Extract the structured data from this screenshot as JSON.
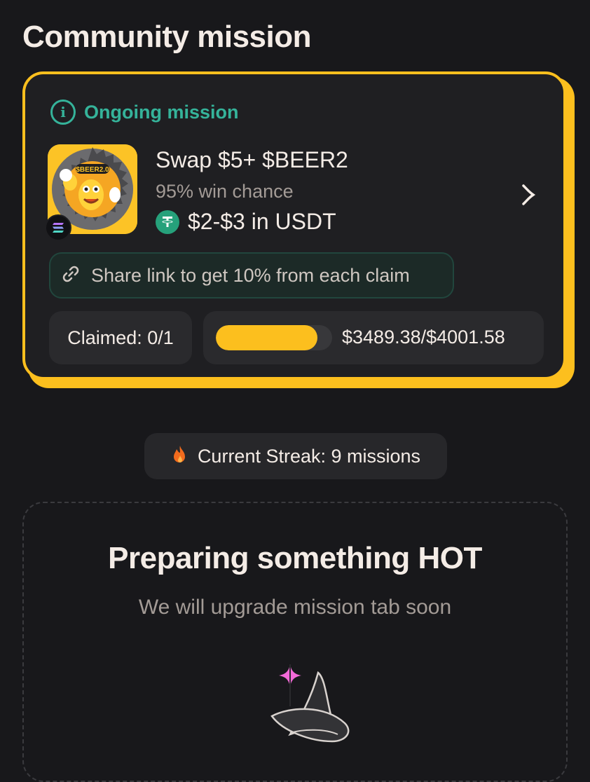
{
  "header": {
    "title": "Community mission"
  },
  "mission": {
    "status_label": "Ongoing mission",
    "title": "Swap $5+ $BEER2",
    "win_chance": "95% win chance",
    "reward": "$2-$3 in USDT",
    "token_logo_text": "$BEER2.0",
    "share_label": "Share link to get 10% from each claim",
    "claimed_label": "Claimed: 0/1",
    "progress_text": "$3489.38/$4001.58",
    "progress_fraction": 0.872
  },
  "streak": {
    "label": "Current Streak: 9 missions"
  },
  "upcoming": {
    "title": "Preparing something HOT",
    "subtitle": "We will upgrade mission tab soon"
  },
  "colors": {
    "accent": "#fcbf1e",
    "success": "#35b39a",
    "usdt": "#26a17b",
    "background": "#18181b"
  },
  "icons": [
    "info-icon",
    "solana-icon",
    "usdt-icon",
    "chevron-right-icon",
    "link-icon",
    "fire-icon",
    "sparkle-icon",
    "wizard-hat-icon"
  ]
}
